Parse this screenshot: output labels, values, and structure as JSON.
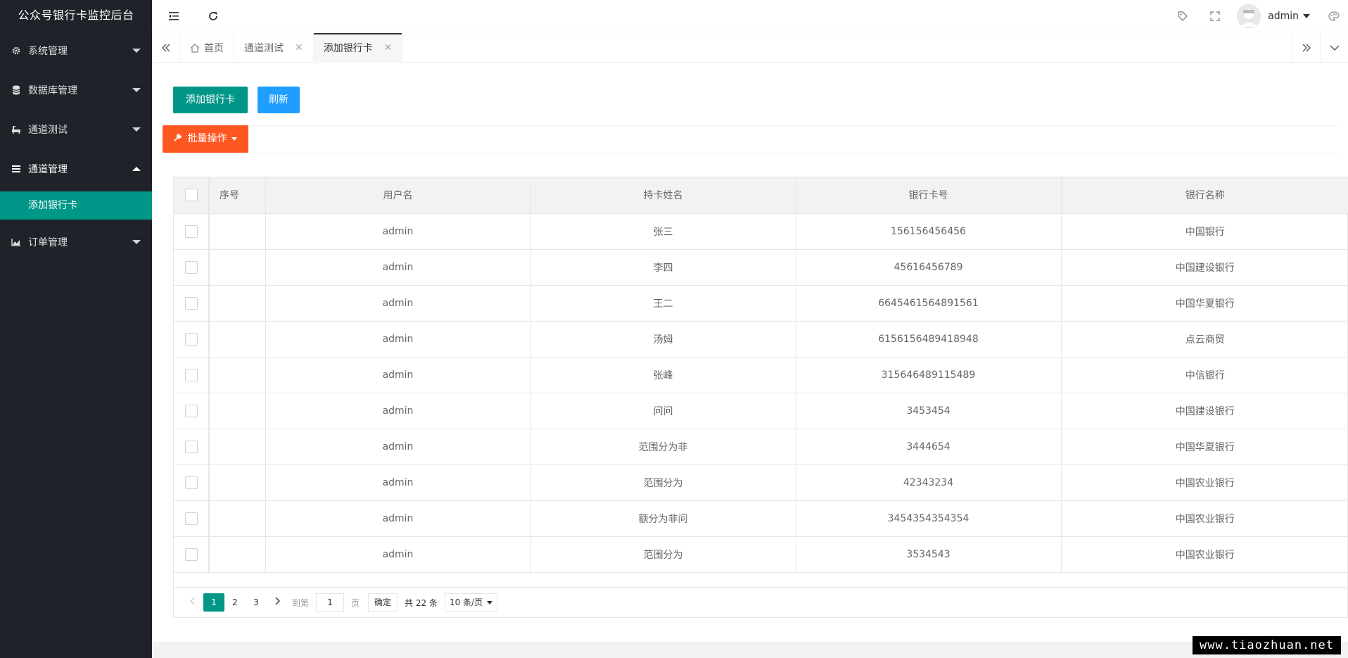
{
  "app": {
    "title": "公众号银行卡监控后台"
  },
  "sidebar": {
    "items": [
      {
        "label": "系统管理",
        "icon": "gear-icon",
        "expanded": false
      },
      {
        "label": "数据库管理",
        "icon": "database-icon",
        "expanded": false
      },
      {
        "label": "通道测试",
        "icon": "bathtub-icon",
        "expanded": false
      },
      {
        "label": "通道管理",
        "icon": "list-icon",
        "expanded": true
      },
      {
        "label": "订单管理",
        "icon": "area-chart-icon",
        "expanded": false
      }
    ],
    "active_child": "添加银行卡"
  },
  "header": {
    "username": "admin",
    "left_icons": [
      "menu-shrink-icon",
      "refresh-icon"
    ],
    "right_icons": [
      "tag-icon",
      "fullscreen-icon",
      "theme-icon"
    ]
  },
  "tabs": [
    {
      "label": "首页",
      "icon": "home-icon",
      "closable": false,
      "active": false
    },
    {
      "label": "通道测试",
      "closable": true,
      "active": false
    },
    {
      "label": "添加银行卡",
      "closable": true,
      "active": true
    }
  ],
  "toolbar": {
    "add_label": "添加银行卡",
    "refresh_label": "刷新",
    "batch_label": "批量操作"
  },
  "table": {
    "columns": [
      "序号",
      "用户名",
      "持卡姓名",
      "银行卡号",
      "银行名称"
    ],
    "rows": [
      {
        "seq": "",
        "user": "admin",
        "holder": "张三",
        "card": "156156456456",
        "bank": "中国银行"
      },
      {
        "seq": "",
        "user": "admin",
        "holder": "李四",
        "card": "45616456789",
        "bank": "中国建设银行"
      },
      {
        "seq": "",
        "user": "admin",
        "holder": "王二",
        "card": "6645461564891561",
        "bank": "中国华夏银行"
      },
      {
        "seq": "",
        "user": "admin",
        "holder": "汤姆",
        "card": "6156156489418948",
        "bank": "点云商贸"
      },
      {
        "seq": "",
        "user": "admin",
        "holder": "张峰",
        "card": "315646489115489",
        "bank": "中信银行"
      },
      {
        "seq": "",
        "user": "admin",
        "holder": "问问",
        "card": "3453454",
        "bank": "中国建设银行"
      },
      {
        "seq": "",
        "user": "admin",
        "holder": "范围分为非",
        "card": "3444654",
        "bank": "中国华夏银行"
      },
      {
        "seq": "",
        "user": "admin",
        "holder": "范围分为",
        "card": "42343234",
        "bank": "中国农业银行"
      },
      {
        "seq": "",
        "user": "admin",
        "holder": "额分为非问",
        "card": "3454354354354",
        "bank": "中国农业银行"
      },
      {
        "seq": "",
        "user": "admin",
        "holder": "范围分为",
        "card": "3534543",
        "bank": "中国农业银行"
      }
    ]
  },
  "pagination": {
    "pages": [
      "1",
      "2",
      "3"
    ],
    "current": "1",
    "goto_prefix": "到第",
    "goto_value": "1",
    "goto_suffix": "页",
    "confirm": "确定",
    "total": "共 22 条",
    "page_size": "10 条/页"
  },
  "watermark": "www.tiaozhuan.net",
  "colors": {
    "sidebar_bg": "#20222a",
    "accent": "#009688",
    "blue": "#1e9fff",
    "orange": "#ff5722"
  }
}
